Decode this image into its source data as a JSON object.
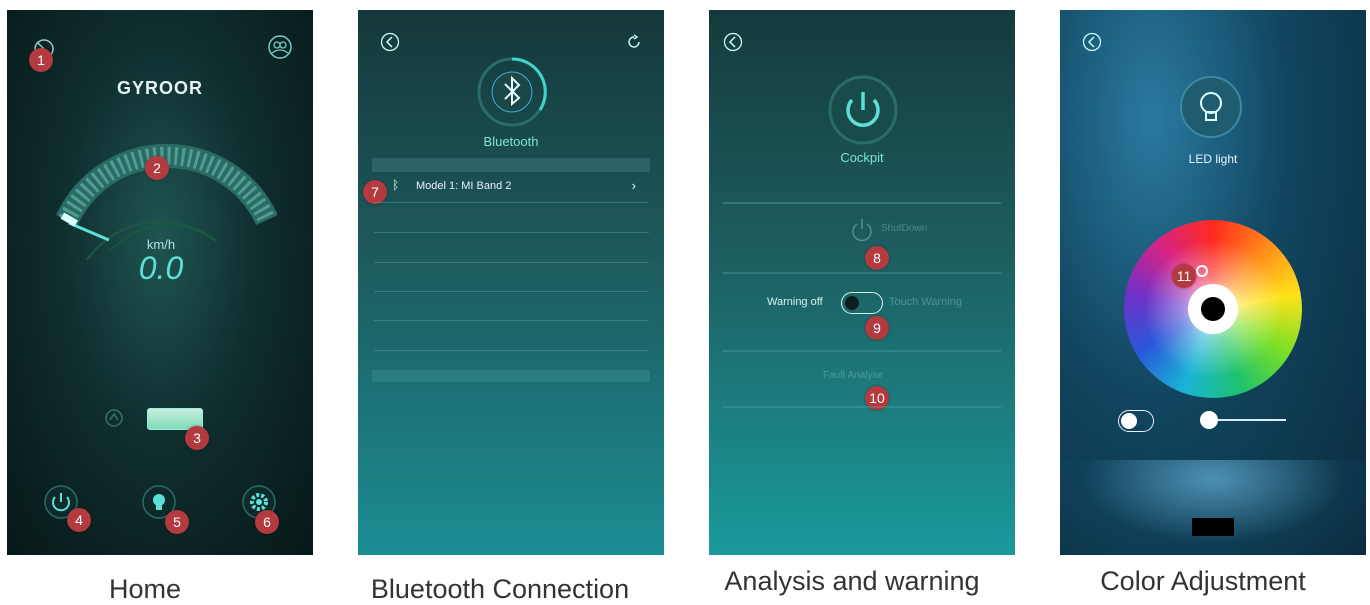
{
  "screens": {
    "home": {
      "brand": "GYROOR",
      "unit": "km/h",
      "speed": "0.0",
      "badges": [
        "1",
        "2",
        "3",
        "4",
        "5",
        "6"
      ]
    },
    "bluetooth": {
      "title": "Bluetooth",
      "device": "Model 1: MI Band 2",
      "badge": "7"
    },
    "analysis": {
      "title": "Cockpit",
      "shutdown": "ShutDown",
      "warning_off": "Warning off",
      "touch_warning": "Touch Warning",
      "fault_analyse": "Fault Analyse",
      "badges": [
        "8",
        "9",
        "10"
      ]
    },
    "color": {
      "title": "LED light",
      "badge": "11"
    }
  },
  "captions": [
    "Home",
    "Bluetooth Connection",
    "Analysis and warning",
    "Color Adjustment"
  ],
  "colors": {
    "accent": "#5ce0d7",
    "badge": "#b33a3f"
  }
}
